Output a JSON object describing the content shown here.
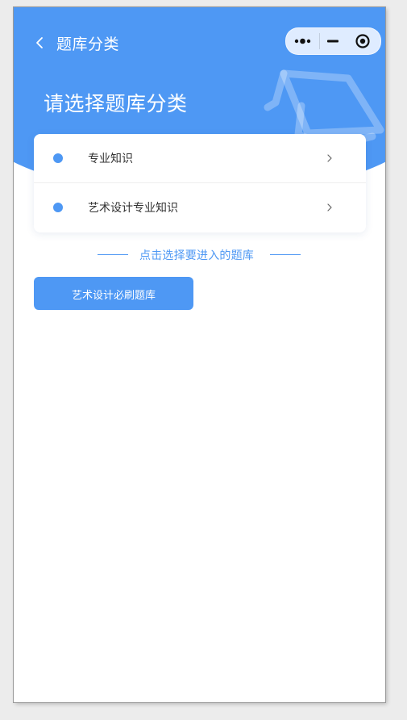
{
  "navbar": {
    "title": "题库分类",
    "back_icon": "chevron-left-icon",
    "capsule_icons": [
      "more-dots-icon",
      "minimize-icon",
      "close-target-icon"
    ]
  },
  "header": {
    "page_title": "请选择题库分类",
    "decoration_icon": "graduation-cap-icon"
  },
  "categories": [
    {
      "label": "专业知识"
    },
    {
      "label": "艺术设计专业知识"
    }
  ],
  "divider": {
    "text": "点击选择要进入的题库"
  },
  "banks": [
    {
      "label": "艺术设计必刷题库"
    }
  ],
  "colors": {
    "accent": "#4e98f4",
    "background": "#ffffff",
    "text": "#333333"
  }
}
